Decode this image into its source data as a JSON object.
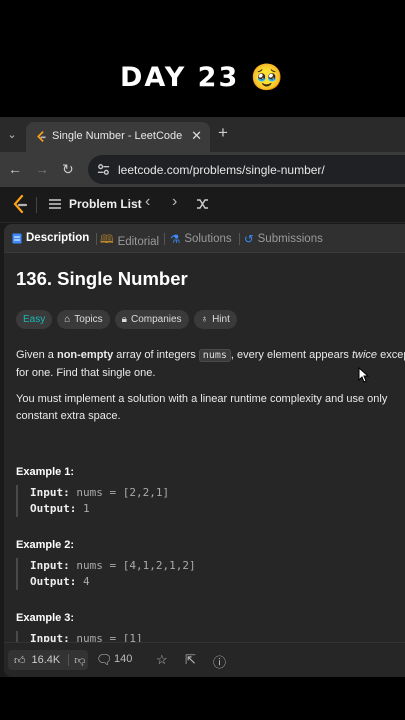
{
  "overlay": {
    "title": "DAY 23",
    "emoji": "🥹"
  },
  "browser": {
    "tab_title": "Single Number - LeetCode",
    "url": "leetcode.com/problems/single-number/"
  },
  "leetcode_nav": {
    "problem_list": "Problem List"
  },
  "panel_tabs": [
    "Description",
    "Editorial",
    "Solutions",
    "Submissions"
  ],
  "problem": {
    "title": "136. Single Number",
    "difficulty": "Easy",
    "chips": [
      "Topics",
      "Companies",
      "Hint"
    ],
    "desc1": {
      "a": "Given a ",
      "b": "non-empty",
      "c": " array of integers ",
      "code": "nums",
      "d": ", every element appears ",
      "e": "twice",
      "f": " except for one. Find that single one."
    },
    "desc2": "You must implement a solution with a linear runtime complexity and use only constant extra space.",
    "examples": [
      {
        "header": "Example 1:",
        "input_label": "Input:",
        "input": "nums = [2,2,1]",
        "output_label": "Output:",
        "output": "1"
      },
      {
        "header": "Example 2:",
        "input_label": "Input:",
        "input": "nums = [4,1,2,1,2]",
        "output_label": "Output:",
        "output": "4"
      },
      {
        "header": "Example 3:",
        "input_label": "Input:",
        "input": "nums = [1]"
      }
    ]
  },
  "footer": {
    "likes": "16.4K",
    "comments": "140"
  },
  "colors": {
    "easy": "#1cb8b8",
    "accent": "#ffa116",
    "panel": "#262626"
  }
}
